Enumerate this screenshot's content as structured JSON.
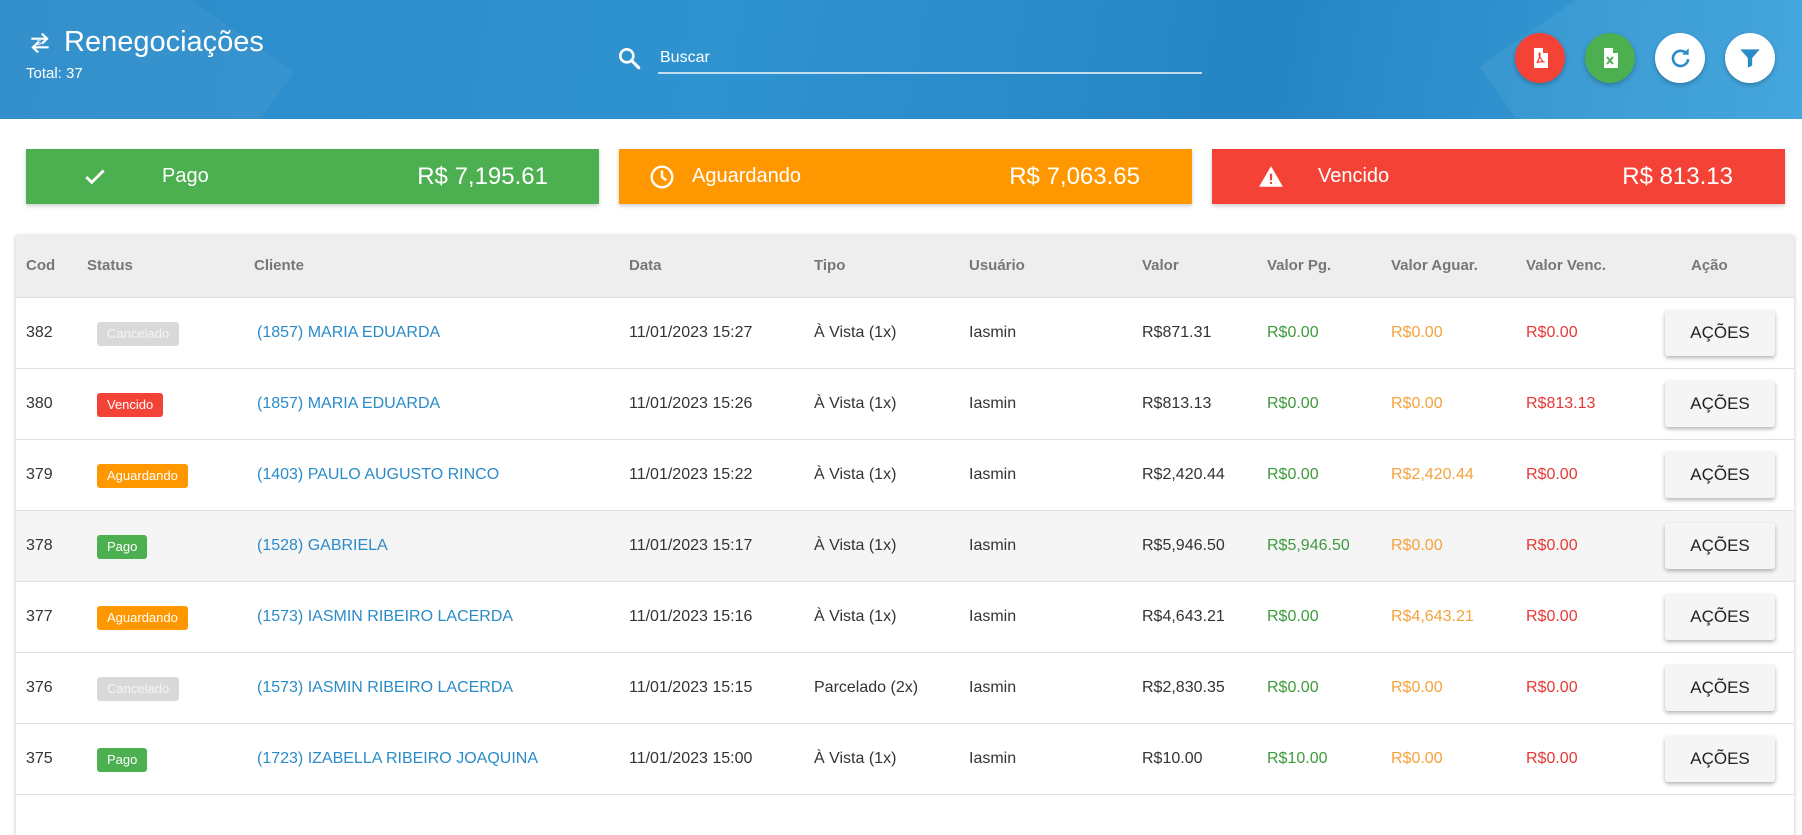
{
  "header": {
    "title": "Renegociações",
    "total": "Total: 37",
    "search_placeholder": "Buscar",
    "buttons": {
      "pdf": "pdf-export",
      "excel": "excel-export",
      "refresh": "refresh",
      "filter": "filter"
    }
  },
  "summary": {
    "pago": {
      "label": "Pago",
      "value": "R$ 7,195.61"
    },
    "aguardando": {
      "label": "Aguardando",
      "value": "R$ 7,063.65"
    },
    "vencido": {
      "label": "Vencido",
      "value": "R$ 813.13"
    }
  },
  "table": {
    "headers": [
      "Cod",
      "Status",
      "Cliente",
      "Data",
      "Tipo",
      "Usuário",
      "Valor",
      "Valor Pg.",
      "Valor Aguar.",
      "Valor Venc.",
      "Ação"
    ],
    "action_label": "AÇÕES",
    "rows": [
      {
        "cod": "382",
        "status": "Cancelado",
        "status_key": "cancelado",
        "cliente": "(1857) MARIA EDUARDA",
        "data": "11/01/2023 15:27",
        "tipo": "À Vista (1x)",
        "usuario": "Iasmin",
        "valor": "R$871.31",
        "valor_pg": "R$0.00",
        "valor_aguar": "R$0.00",
        "valor_venc": "R$0.00"
      },
      {
        "cod": "380",
        "status": "Vencido",
        "status_key": "vencido",
        "cliente": "(1857) MARIA EDUARDA",
        "data": "11/01/2023 15:26",
        "tipo": "À Vista (1x)",
        "usuario": "Iasmin",
        "valor": "R$813.13",
        "valor_pg": "R$0.00",
        "valor_aguar": "R$0.00",
        "valor_venc": "R$813.13"
      },
      {
        "cod": "379",
        "status": "Aguardando",
        "status_key": "aguardando",
        "cliente": "(1403) PAULO AUGUSTO RINCO",
        "data": "11/01/2023 15:22",
        "tipo": "À Vista (1x)",
        "usuario": "Iasmin",
        "valor": "R$2,420.44",
        "valor_pg": "R$0.00",
        "valor_aguar": "R$2,420.44",
        "valor_venc": "R$0.00"
      },
      {
        "cod": "378",
        "status": "Pago",
        "status_key": "pago",
        "cliente": "(1528) GABRIELA",
        "data": "11/01/2023 15:17",
        "tipo": "À Vista (1x)",
        "usuario": "Iasmin",
        "valor": "R$5,946.50",
        "valor_pg": "R$5,946.50",
        "valor_aguar": "R$0.00",
        "valor_venc": "R$0.00"
      },
      {
        "cod": "377",
        "status": "Aguardando",
        "status_key": "aguardando",
        "cliente": "(1573) IASMIN RIBEIRO LACERDA",
        "data": "11/01/2023 15:16",
        "tipo": "À Vista (1x)",
        "usuario": "Iasmin",
        "valor": "R$4,643.21",
        "valor_pg": "R$0.00",
        "valor_aguar": "R$4,643.21",
        "valor_venc": "R$0.00"
      },
      {
        "cod": "376",
        "status": "Cancelado",
        "status_key": "cancelado",
        "cliente": "(1573) IASMIN RIBEIRO LACERDA",
        "data": "11/01/2023 15:15",
        "tipo": "Parcelado (2x)",
        "usuario": "Iasmin",
        "valor": "R$2,830.35",
        "valor_pg": "R$0.00",
        "valor_aguar": "R$0.00",
        "valor_venc": "R$0.00"
      },
      {
        "cod": "375",
        "status": "Pago",
        "status_key": "pago",
        "cliente": "(1723) IZABELLA RIBEIRO JOAQUINA",
        "data": "11/01/2023 15:00",
        "tipo": "À Vista (1x)",
        "usuario": "Iasmin",
        "valor": "R$10.00",
        "valor_pg": "R$10.00",
        "valor_aguar": "R$0.00",
        "valor_venc": "R$0.00"
      }
    ]
  },
  "colors": {
    "header": "#2a8bc9",
    "pago": "#4caf50",
    "aguardando": "#ff9800",
    "vencido": "#f44336",
    "cancelado": "#d9d9d9",
    "link": "#2a8bc9"
  }
}
